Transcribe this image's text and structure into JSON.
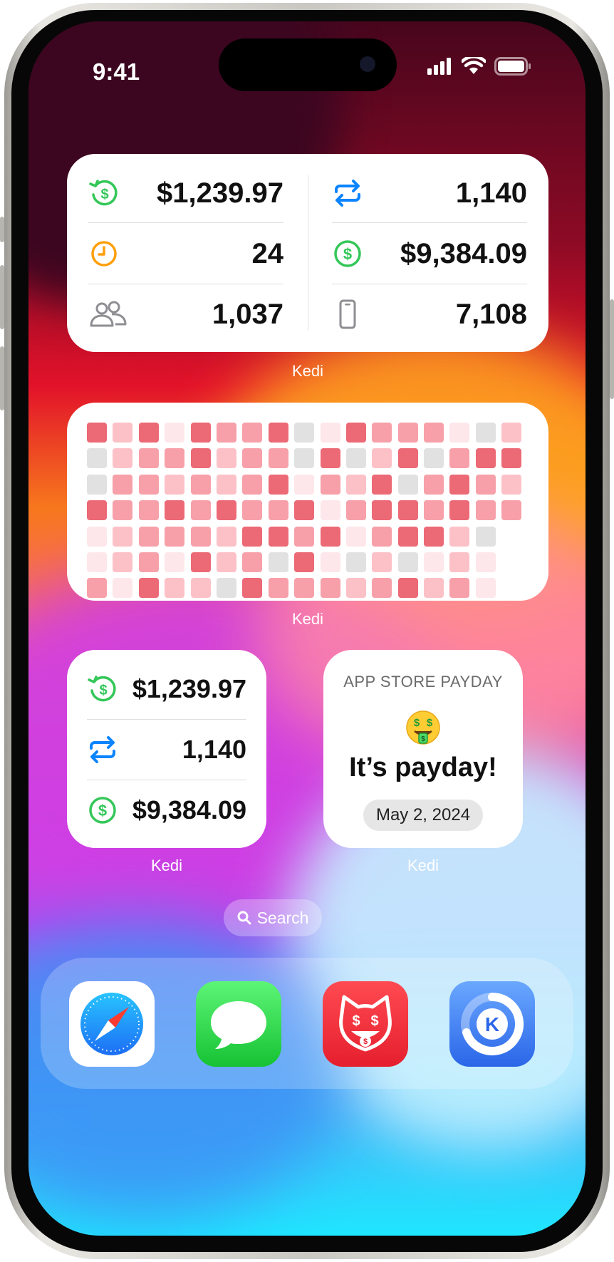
{
  "status_bar": {
    "time": "9:41"
  },
  "widget_large": {
    "label": "Kedi",
    "left_rows": [
      {
        "icon": "refund-dollar-icon",
        "value": "$1,239.97"
      },
      {
        "icon": "clock-icon",
        "value": "24"
      },
      {
        "icon": "people-icon",
        "value": "1,037"
      }
    ],
    "right_rows": [
      {
        "icon": "repeat-arrows-icon",
        "value": "1,140"
      },
      {
        "icon": "dollar-circle-icon",
        "value": "$9,384.09"
      },
      {
        "icon": "phone-icon",
        "value": "7,108"
      }
    ]
  },
  "widget_heatmap": {
    "label": "Kedi",
    "grid": [
      [
        4,
        2,
        4,
        1,
        4,
        3,
        3,
        4,
        0,
        1,
        4,
        3,
        3,
        3,
        1,
        0,
        2
      ],
      [
        0,
        2,
        3,
        3,
        4,
        2,
        3,
        3,
        0,
        4,
        0,
        2,
        4,
        0,
        3,
        4,
        4
      ],
      [
        0,
        3,
        3,
        2,
        3,
        2,
        3,
        4,
        1,
        3,
        2,
        4,
        0,
        3,
        4,
        3,
        2
      ],
      [
        4,
        3,
        3,
        4,
        3,
        4,
        3,
        3,
        4,
        1,
        3,
        4,
        4,
        3,
        4,
        3,
        3
      ],
      [
        1,
        2,
        3,
        3,
        3,
        2,
        4,
        4,
        3,
        4,
        1,
        3,
        4,
        4,
        2,
        0,
        -1
      ],
      [
        1,
        2,
        3,
        1,
        4,
        2,
        3,
        0,
        4,
        1,
        0,
        2,
        0,
        1,
        2,
        1,
        -1
      ],
      [
        3,
        1,
        4,
        2,
        2,
        0,
        4,
        3,
        3,
        3,
        2,
        3,
        4,
        2,
        3,
        1,
        -1
      ]
    ],
    "colors": [
      "#e1e1e1",
      "#fde7ea",
      "#fcc1c7",
      "#f7a0a9",
      "#ec6976"
    ]
  },
  "widget_small_stats": {
    "label": "Kedi",
    "rows": [
      {
        "icon": "refund-dollar-icon",
        "value": "$1,239.97"
      },
      {
        "icon": "repeat-arrows-icon",
        "value": "1,140"
      },
      {
        "icon": "dollar-circle-icon",
        "value": "$9,384.09"
      }
    ]
  },
  "widget_payday": {
    "label": "Kedi",
    "header": "APP STORE PAYDAY",
    "emoji": "money-mouth-face-icon",
    "title": "It’s payday!",
    "date": "May 2, 2024"
  },
  "search": {
    "label": "Search"
  },
  "dock": {
    "apps": [
      "Safari",
      "Messages",
      "Money Cat",
      "Kedi"
    ]
  },
  "colors": {
    "green": "#34c759",
    "blue": "#0a84ff",
    "orange": "#ff9f0a",
    "gray": "#8e8e93"
  }
}
